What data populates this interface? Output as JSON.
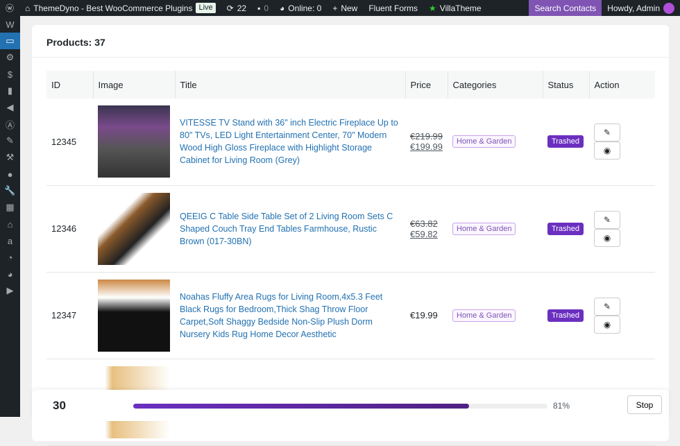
{
  "adminbar": {
    "site": "ThemeDyno - Best WooCommerce Plugins",
    "live": "Live",
    "updates": "22",
    "comments": "0",
    "online": "Online: 0",
    "new": "New",
    "fluent": "Fluent Forms",
    "villa": "VillaTheme",
    "search_contacts": "Search Contacts",
    "howdy": "Howdy, Admin"
  },
  "panel": {
    "title": "Products: 37"
  },
  "table": {
    "headers": [
      "ID",
      "Image",
      "Title",
      "Price",
      "Categories",
      "Status",
      "Action"
    ],
    "rows": [
      {
        "id": "12345",
        "title": "VITESSE TV Stand with 36\" inch Electric Fireplace Up to 80\" TVs, LED Light Entertainment Center, 70\" Modern Wood High Gloss Fireplace with Highlight Storage Cabinet for Living Room (Grey)",
        "old_price": "€219.99",
        "price": "€199.99",
        "category": "Home & Garden",
        "status": "Trashed"
      },
      {
        "id": "12346",
        "title": "QEEIG C Table Side Table Set of 2 Living Room Sets C Shaped Couch Tray End Tables Farmhouse, Rustic Brown (017-30BN)",
        "old_price": "€63.82",
        "price": "€59.82",
        "category": "Home & Garden",
        "status": "Trashed"
      },
      {
        "id": "12347",
        "title": "Noahas Fluffy Area Rugs for Living Room,4x5.3 Feet Black Rugs for Bedroom,Thick Shag Throw Floor Carpet,Soft Shaggy Bedside Non-Slip Plush Dorm Nursery Kids Rug Home Decor Aesthetic",
        "old_price": "",
        "price": "€19.99",
        "category": "Home & Garden",
        "status": "Trashed"
      },
      {
        "id": "",
        "title": "Floor Lamp with Shelves for Living Room, Shelf Floor Lamp",
        "old_price": "",
        "price": "",
        "category": "",
        "status": ""
      }
    ]
  },
  "footer": {
    "count": "30",
    "progress_percent": 81,
    "progress_label": "81%",
    "stop": "Stop"
  }
}
